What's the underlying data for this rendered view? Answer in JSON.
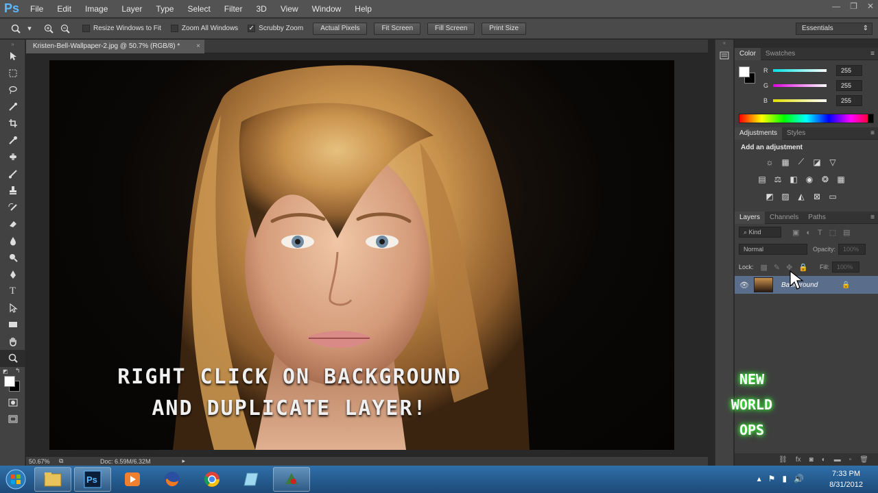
{
  "app": {
    "logo": "Ps"
  },
  "menu": [
    "File",
    "Edit",
    "Image",
    "Layer",
    "Type",
    "Select",
    "Filter",
    "3D",
    "View",
    "Window",
    "Help"
  ],
  "options_bar": {
    "checkboxes": [
      {
        "label": "Resize Windows to Fit",
        "checked": false
      },
      {
        "label": "Zoom All Windows",
        "checked": false
      },
      {
        "label": "Scrubby Zoom",
        "checked": true
      }
    ],
    "buttons": [
      "Actual Pixels",
      "Fit Screen",
      "Fill Screen",
      "Print Size"
    ],
    "workspace": "Essentials"
  },
  "document": {
    "tab_title": "Kristen-Bell-Wallpaper-2.jpg @ 50.7% (RGB/8) *",
    "overlay_caption_line1": "RIGHT CLICK ON BACKGROUND",
    "overlay_caption_line2": "AND DUPLICATE LAYER!",
    "watermark_lines": [
      "NEW",
      "WORLD",
      "OPS"
    ],
    "status_zoom": "50.67%",
    "status_doc": "Doc: 6.59M/6.32M"
  },
  "color_panel": {
    "tabs": [
      "Color",
      "Swatches"
    ],
    "active_tab": "Color",
    "channels": [
      {
        "label": "R",
        "value": "255",
        "color": "#00e0e0"
      },
      {
        "label": "G",
        "value": "255",
        "color": "#e000e0"
      },
      {
        "label": "B",
        "value": "255",
        "color": "#e0e000"
      }
    ]
  },
  "adjustments_panel": {
    "tabs": [
      "Adjustments",
      "Styles"
    ],
    "active_tab": "Adjustments",
    "heading": "Add an adjustment",
    "icon_rows": [
      [
        "brightness-icon",
        "levels-icon",
        "curves-icon",
        "exposure-icon"
      ],
      [
        "vibrance-icon",
        "hue-saturation-icon",
        "color-balance-icon",
        "black-white-icon",
        "photo-filter-icon",
        "channel-mixer-icon"
      ],
      [
        "invert-icon",
        "posterize-icon",
        "threshold-icon",
        "selective-color-icon",
        "gradient-map-icon"
      ]
    ]
  },
  "layers_panel": {
    "tabs": [
      "Layers",
      "Channels",
      "Paths"
    ],
    "active_tab": "Layers",
    "filter_kind": "Kind",
    "blend_mode": "Normal",
    "opacity_label": "Opacity:",
    "opacity_value": "100%",
    "lock_label": "Lock:",
    "fill_label": "Fill:",
    "fill_value": "100%",
    "layers": [
      {
        "name": "Background",
        "visible": true,
        "locked": true
      }
    ]
  },
  "taskbar": {
    "apps": [
      "start",
      "explorer",
      "photoshop",
      "media-player",
      "firefox",
      "chrome",
      "notepad",
      "tool"
    ],
    "time": "7:33 PM",
    "date": "8/31/2012"
  }
}
